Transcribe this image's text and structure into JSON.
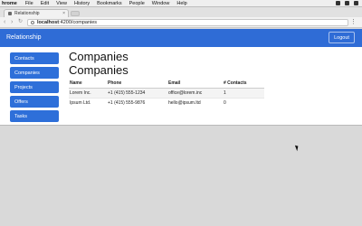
{
  "menubar": {
    "app": "hrome",
    "items": [
      "File",
      "Edit",
      "View",
      "History",
      "Bookmarks",
      "People",
      "Window",
      "Help"
    ]
  },
  "browser": {
    "tab_title": "Relationship",
    "url_host": "localhost",
    "url_rest": ":4200/companies"
  },
  "app": {
    "brand": "Relationship",
    "logout_label": "Logout",
    "accent": "#2f6cd6"
  },
  "sidebar": {
    "items": [
      {
        "label": "Contacts"
      },
      {
        "label": "Companies"
      },
      {
        "label": "Projects"
      },
      {
        "label": "Offers"
      },
      {
        "label": "Tasks"
      }
    ]
  },
  "main": {
    "heading": "Companies",
    "subheading": "Companies",
    "table": {
      "headers": [
        "Name",
        "Phone",
        "Email",
        "# Contacts"
      ],
      "rows": [
        [
          "Lorem Inc.",
          "+1 (415) 555-1234",
          "office@lorem.inc",
          "1"
        ],
        [
          "Ipsum Ltd.",
          "+1 (415) 555-9876",
          "hello@ipsum.ltd",
          "0"
        ]
      ]
    }
  }
}
